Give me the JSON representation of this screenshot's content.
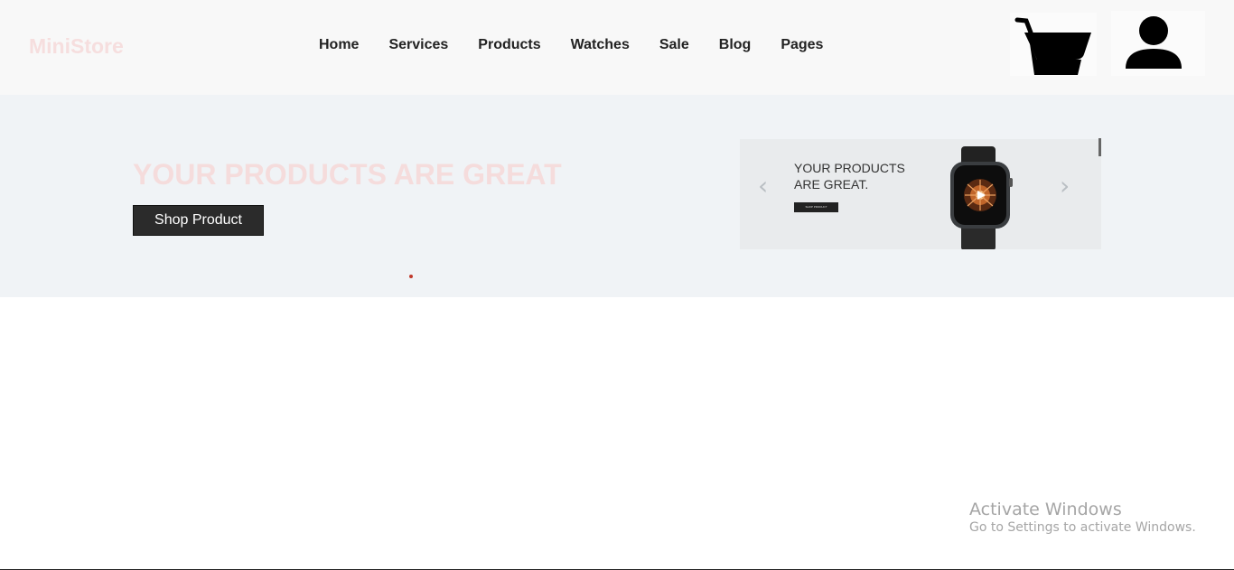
{
  "header": {
    "logo": "MiniStore",
    "nav": [
      "Home",
      "Services",
      "Products",
      "Watches",
      "Sale",
      "Blog",
      "Pages"
    ],
    "cart_icon": "cart-icon",
    "user_icon": "user-icon"
  },
  "hero": {
    "title": "YOUR PRODUCTS ARE GREAT",
    "button_label": "Shop Product",
    "banner": {
      "line1": "YOUR PRODUCTS",
      "line2": "ARE GREAT.",
      "button_label": "SHOP PRODUCT",
      "prev_icon": "chevron-left-icon",
      "next_icon": "chevron-right-icon"
    }
  },
  "watermark": {
    "title": "Activate Windows",
    "subtitle": "Go to Settings to activate Windows."
  },
  "colors": {
    "logo": "#f6dede",
    "hero_bg": "#f0f3f6",
    "hero_title": "#f5dcdc",
    "button_bg": "#2b2b2b",
    "dot": "#c0392b"
  }
}
